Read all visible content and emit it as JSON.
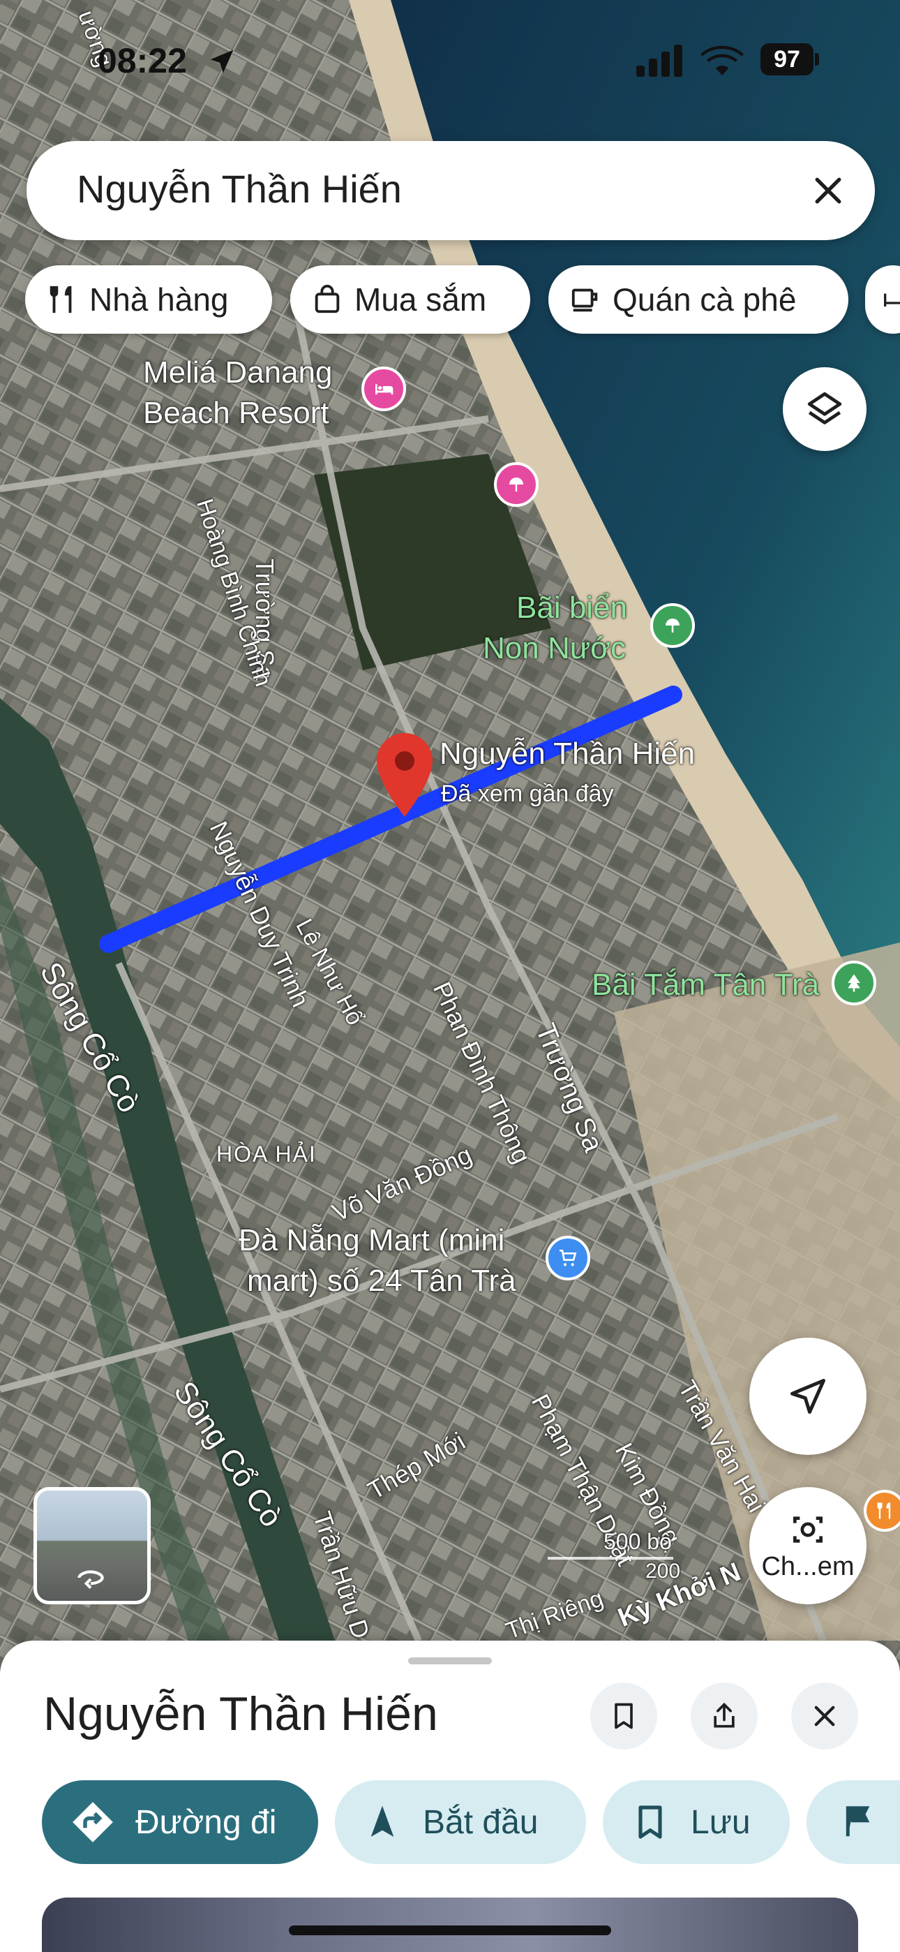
{
  "status_bar": {
    "time": "08:22",
    "battery": "97"
  },
  "search": {
    "value": "Nguyễn Thần Hiến"
  },
  "chips": [
    {
      "label": "Nhà hàng",
      "icon": "restaurant-icon"
    },
    {
      "label": "Mua sắm",
      "icon": "shopping-bag-icon"
    },
    {
      "label": "Quán cà phê",
      "icon": "coffee-icon"
    }
  ],
  "map": {
    "street_labels": {
      "truong_sa_1": "Trường Sa",
      "hoang_binh_chinh": "Hoàng Bình Chính",
      "nguyen_duy_trinh": "Nguyễn Duy Trinh",
      "le_nhu_ho": "Lê Như Hổ",
      "phan_dinh_thong": "Phan Đình Thông",
      "truong_sa_2": "Trường Sa",
      "vo_van_dong": "Võ Văn Đồng",
      "song_co_co_1": "Sông Cổ Cò",
      "song_co_co_2": "Sông Cổ Cò",
      "thep_moi": "Thép Mới",
      "pham_than_duat": "Phạm Thận Duật",
      "kim_dong": "Kim Đồng",
      "tran_van_hai": "Trần Văn Hai",
      "tran_huu_d": "Trần Hữu D",
      "thi_rieng": "Thị Riêng",
      "ky_khoi_n": "Kỳ Khởi N",
      "truon": "ường"
    },
    "area_label": "HÒA HẢI",
    "places": {
      "melia": "Meliá Danang\nBeach Resort",
      "bai_bien_line1": "Bãi biển",
      "bai_bien_line2": "Non Nước",
      "bai_tam": "Bãi Tắm Tân Trà",
      "mart_line1": "Đà Nẵng Mart (mini",
      "mart_line2": "mart) số 24 Tân Trà"
    },
    "pin": {
      "title": "Nguyễn Thần Hiến",
      "subtitle": "Đã xem gần đây"
    },
    "scale": {
      "top": "500 bộ",
      "bottom": "200"
    },
    "colors": {
      "route": "#1a3cff",
      "pin": "#e0362c",
      "hotel_poi": "#e64aa0",
      "beach_poi": "#3da35a",
      "shop_poi": "#3d8ef0"
    }
  },
  "controls": {
    "camera_label": "Ch...em"
  },
  "sheet": {
    "title": "Nguyễn Thần Hiến",
    "actions": [
      {
        "label": "Đường đi",
        "icon": "directions-icon"
      },
      {
        "label": "Bắt đầu",
        "icon": "navigation-arrow-icon"
      },
      {
        "label": "Lưu",
        "icon": "bookmark-icon"
      }
    ]
  }
}
